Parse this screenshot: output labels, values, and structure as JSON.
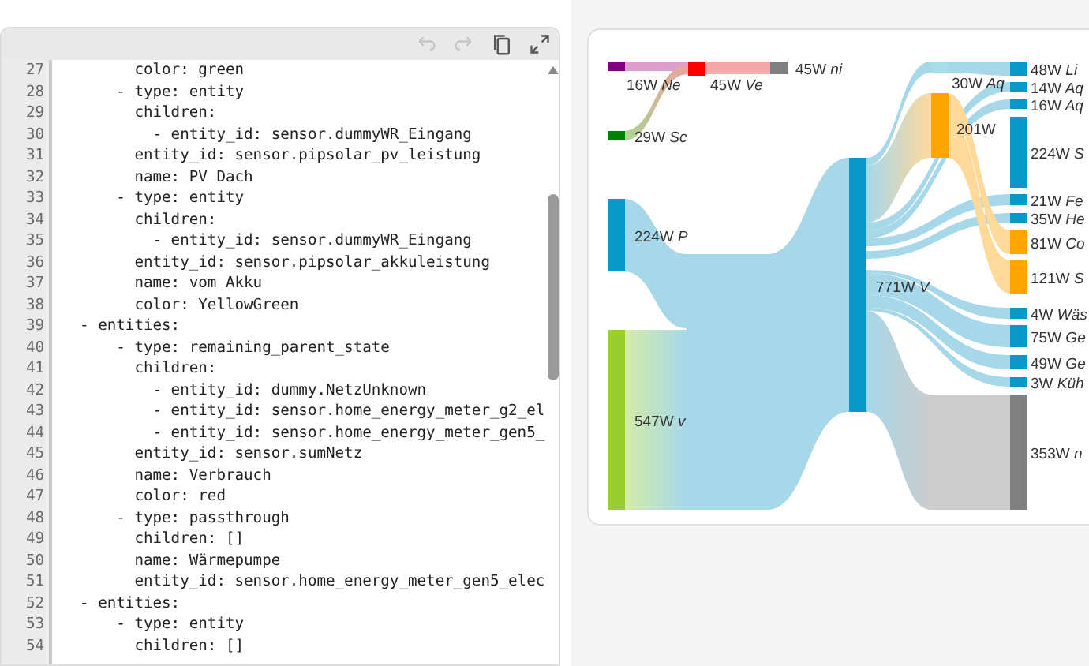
{
  "editor": {
    "toolbar": [
      {
        "disabled": true
      },
      {
        "disabled": true
      },
      {
        "disabled": false
      },
      {
        "disabled": false
      }
    ],
    "lines": [
      {
        "number": "27",
        "code": "        color: green"
      },
      {
        "number": "28",
        "code": "      - type: entity"
      },
      {
        "number": "29",
        "code": "        children:"
      },
      {
        "number": "30",
        "code": "          - entity_id: sensor.dummyWR_Eingang"
      },
      {
        "number": "31",
        "code": "        entity_id: sensor.pipsolar_pv_leistung"
      },
      {
        "number": "32",
        "code": "        name: PV Dach"
      },
      {
        "number": "33",
        "code": "      - type: entity"
      },
      {
        "number": "34",
        "code": "        children:"
      },
      {
        "number": "35",
        "code": "          - entity_id: sensor.dummyWR_Eingang"
      },
      {
        "number": "36",
        "code": "        entity_id: sensor.pipsolar_akkuleistung"
      },
      {
        "number": "37",
        "code": "        name: vom Akku"
      },
      {
        "number": "38",
        "code": "        color: YellowGreen"
      },
      {
        "number": "39",
        "code": "  - entities:"
      },
      {
        "number": "40",
        "code": "      - type: remaining_parent_state"
      },
      {
        "number": "41",
        "code": "        children:"
      },
      {
        "number": "42",
        "code": "          - entity_id: dummy.NetzUnknown"
      },
      {
        "number": "43",
        "code": "          - entity_id: sensor.home_energy_meter_g2_el"
      },
      {
        "number": "44",
        "code": "          - entity_id: sensor.home_energy_meter_gen5_"
      },
      {
        "number": "45",
        "code": "        entity_id: sensor.sumNetz"
      },
      {
        "number": "46",
        "code": "        name: Verbrauch"
      },
      {
        "number": "47",
        "code": "        color: red"
      },
      {
        "number": "48",
        "code": "      - type: passthrough"
      },
      {
        "number": "49",
        "code": "        children: []"
      },
      {
        "number": "50",
        "code": "        name: Wärmepumpe"
      },
      {
        "number": "51",
        "code": "        entity_id: sensor.home_energy_meter_gen5_elec"
      },
      {
        "number": "52",
        "code": "  - entities:"
      },
      {
        "number": "53",
        "code": "      - type: entity"
      },
      {
        "number": "54",
        "code": "        children: []"
      }
    ]
  },
  "sankey": {
    "nodes": [
      {
        "value": "16W",
        "name": "Ne",
        "color": "#800080"
      },
      {
        "value": "45W",
        "name": "Ve",
        "color": "#ff0000"
      },
      {
        "value": "45W",
        "name": "ni",
        "color": "#808080"
      },
      {
        "value": "29W",
        "name": "Sc",
        "color": "#008000"
      },
      {
        "value": "224W",
        "name": "P",
        "color": "#0a98c8"
      },
      {
        "value": "547W",
        "name": "v",
        "color": "#9acd32"
      },
      {
        "value": "771W",
        "name": "V",
        "color": "#0a98c8"
      },
      {
        "value": "30W",
        "name": "Aq",
        "color": "#a8dcea"
      },
      {
        "value": "201W",
        "color": "#ffa500"
      },
      {
        "color": "#cccccc"
      },
      {
        "value": "48W",
        "name": "Li",
        "color": "#0a98c8"
      },
      {
        "value": "14W",
        "name": "Aq",
        "color": "#0a98c8"
      },
      {
        "value": "16W",
        "name": "Aq",
        "color": "#0a98c8"
      },
      {
        "value": "224W",
        "name": "S",
        "color": "#0a98c8"
      },
      {
        "value": "21W",
        "name": "Fe",
        "color": "#0a98c8"
      },
      {
        "value": "35W",
        "name": "He",
        "color": "#0a98c8"
      },
      {
        "value": "81W",
        "name": "Co",
        "color": "#ffa500"
      },
      {
        "value": "121W",
        "name": "S",
        "color": "#ffa500"
      },
      {
        "value": "4W",
        "name": "Wäs",
        "color": "#0a98c8"
      },
      {
        "value": "75W",
        "name": "Ge",
        "color": "#0a98c8"
      },
      {
        "value": "49W",
        "name": "Ge",
        "color": "#0a98c8"
      },
      {
        "value": "3W",
        "name": "Küh",
        "color": "#0a98c8"
      },
      {
        "value": "353W",
        "name": "n",
        "color": "#808080"
      }
    ]
  }
}
